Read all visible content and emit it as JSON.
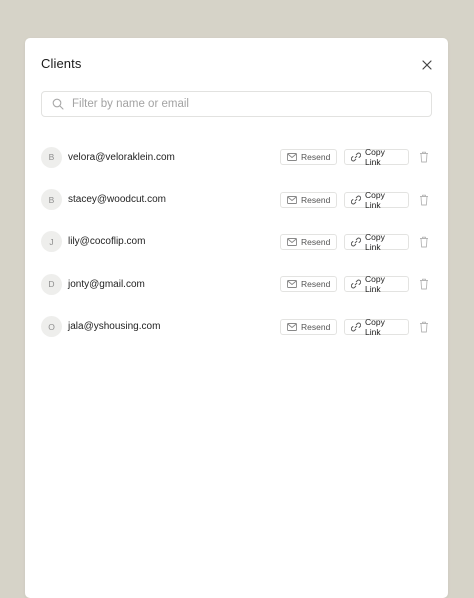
{
  "modal": {
    "title": "Clients",
    "search": {
      "placeholder": "Filter by name or email",
      "value": ""
    },
    "resend_label": "Resend",
    "copy_label": "Copy Link",
    "clients": [
      {
        "initial": "B",
        "email": "velora@veloraklein.com"
      },
      {
        "initial": "B",
        "email": "stacey@woodcut.com"
      },
      {
        "initial": "J",
        "email": "lily@cocoflip.com"
      },
      {
        "initial": "D",
        "email": "jonty@gmail.com"
      },
      {
        "initial": "O",
        "email": "jala@yshousing.com"
      }
    ]
  },
  "colors": {
    "backdrop": "#d6d3c8",
    "surface": "#ffffff",
    "border": "#e2e2e0",
    "avatar_bg": "#eeeeec"
  }
}
